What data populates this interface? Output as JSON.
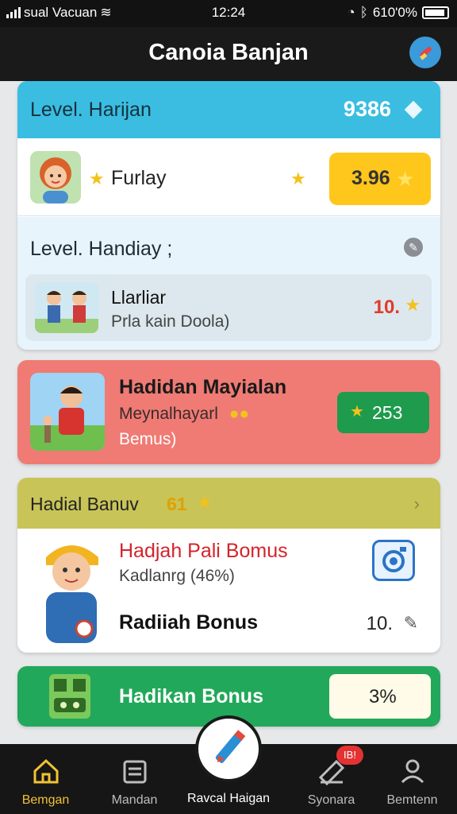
{
  "status": {
    "carrier": "sual Vacuan",
    "time": "12:24",
    "battery": "610'0%"
  },
  "header": {
    "title": "Canoia Banjan",
    "action_icon": "edit-icon"
  },
  "card_level": {
    "title": "Level. Harijan",
    "score": "9386",
    "player_name": "Furlay",
    "player_score": "3.96",
    "sub_title": "Level. Handiay ;",
    "inner": {
      "title": "Llarliar",
      "subtitle": "Prla kain Doola)",
      "value": "10."
    }
  },
  "card_hadidan": {
    "title": "Hadidan Mayialan",
    "subtitle": "Meynalhayarl",
    "tag": "Bemus)",
    "value": "253"
  },
  "card_hadial": {
    "title": "Hadial Banuv",
    "count": "61",
    "red_title": "Hadjah Pali Bomus",
    "percent_text": "Kadlanrg (46%)",
    "bonus_label": "Radiiah Bonus",
    "bonus_value": "10."
  },
  "card_hadikan": {
    "label": "Hadikan Bonus",
    "value": "3%"
  },
  "nav": {
    "items": [
      {
        "label": "Bemgan",
        "icon": "home-icon"
      },
      {
        "label": "Mandan",
        "icon": "calendar-icon"
      },
      {
        "label": "Ravcal Haigan",
        "icon": "pencil-icon"
      },
      {
        "label": "Syonara",
        "icon": "ticket-icon",
        "badge": "IB!"
      },
      {
        "label": "Bemtenn",
        "icon": "profile-icon"
      }
    ]
  },
  "colors": {
    "accent": "#3bbde2",
    "brand_yellow": "#ffc61c",
    "nav_active": "#f2c233"
  }
}
